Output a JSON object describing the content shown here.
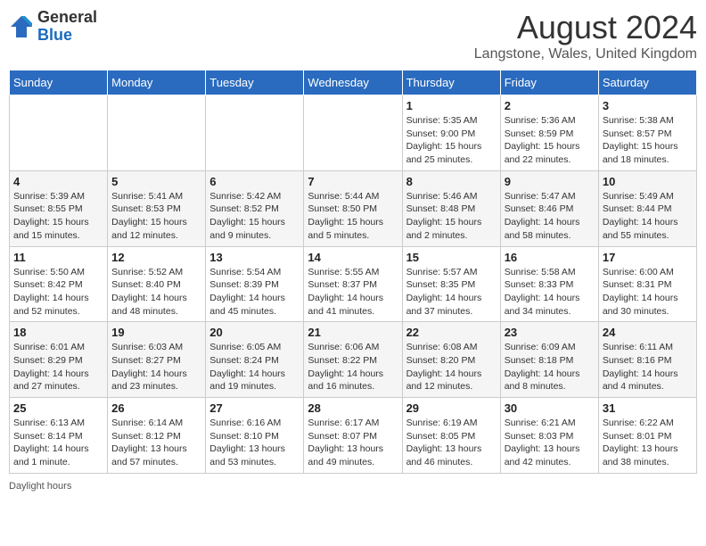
{
  "header": {
    "logo_general": "General",
    "logo_blue": "Blue",
    "main_title": "August 2024",
    "subtitle": "Langstone, Wales, United Kingdom"
  },
  "weekdays": [
    "Sunday",
    "Monday",
    "Tuesday",
    "Wednesday",
    "Thursday",
    "Friday",
    "Saturday"
  ],
  "weeks": [
    [
      {
        "num": "",
        "info": ""
      },
      {
        "num": "",
        "info": ""
      },
      {
        "num": "",
        "info": ""
      },
      {
        "num": "",
        "info": ""
      },
      {
        "num": "1",
        "info": "Sunrise: 5:35 AM\nSunset: 9:00 PM\nDaylight: 15 hours\nand 25 minutes."
      },
      {
        "num": "2",
        "info": "Sunrise: 5:36 AM\nSunset: 8:59 PM\nDaylight: 15 hours\nand 22 minutes."
      },
      {
        "num": "3",
        "info": "Sunrise: 5:38 AM\nSunset: 8:57 PM\nDaylight: 15 hours\nand 18 minutes."
      }
    ],
    [
      {
        "num": "4",
        "info": "Sunrise: 5:39 AM\nSunset: 8:55 PM\nDaylight: 15 hours\nand 15 minutes."
      },
      {
        "num": "5",
        "info": "Sunrise: 5:41 AM\nSunset: 8:53 PM\nDaylight: 15 hours\nand 12 minutes."
      },
      {
        "num": "6",
        "info": "Sunrise: 5:42 AM\nSunset: 8:52 PM\nDaylight: 15 hours\nand 9 minutes."
      },
      {
        "num": "7",
        "info": "Sunrise: 5:44 AM\nSunset: 8:50 PM\nDaylight: 15 hours\nand 5 minutes."
      },
      {
        "num": "8",
        "info": "Sunrise: 5:46 AM\nSunset: 8:48 PM\nDaylight: 15 hours\nand 2 minutes."
      },
      {
        "num": "9",
        "info": "Sunrise: 5:47 AM\nSunset: 8:46 PM\nDaylight: 14 hours\nand 58 minutes."
      },
      {
        "num": "10",
        "info": "Sunrise: 5:49 AM\nSunset: 8:44 PM\nDaylight: 14 hours\nand 55 minutes."
      }
    ],
    [
      {
        "num": "11",
        "info": "Sunrise: 5:50 AM\nSunset: 8:42 PM\nDaylight: 14 hours\nand 52 minutes."
      },
      {
        "num": "12",
        "info": "Sunrise: 5:52 AM\nSunset: 8:40 PM\nDaylight: 14 hours\nand 48 minutes."
      },
      {
        "num": "13",
        "info": "Sunrise: 5:54 AM\nSunset: 8:39 PM\nDaylight: 14 hours\nand 45 minutes."
      },
      {
        "num": "14",
        "info": "Sunrise: 5:55 AM\nSunset: 8:37 PM\nDaylight: 14 hours\nand 41 minutes."
      },
      {
        "num": "15",
        "info": "Sunrise: 5:57 AM\nSunset: 8:35 PM\nDaylight: 14 hours\nand 37 minutes."
      },
      {
        "num": "16",
        "info": "Sunrise: 5:58 AM\nSunset: 8:33 PM\nDaylight: 14 hours\nand 34 minutes."
      },
      {
        "num": "17",
        "info": "Sunrise: 6:00 AM\nSunset: 8:31 PM\nDaylight: 14 hours\nand 30 minutes."
      }
    ],
    [
      {
        "num": "18",
        "info": "Sunrise: 6:01 AM\nSunset: 8:29 PM\nDaylight: 14 hours\nand 27 minutes."
      },
      {
        "num": "19",
        "info": "Sunrise: 6:03 AM\nSunset: 8:27 PM\nDaylight: 14 hours\nand 23 minutes."
      },
      {
        "num": "20",
        "info": "Sunrise: 6:05 AM\nSunset: 8:24 PM\nDaylight: 14 hours\nand 19 minutes."
      },
      {
        "num": "21",
        "info": "Sunrise: 6:06 AM\nSunset: 8:22 PM\nDaylight: 14 hours\nand 16 minutes."
      },
      {
        "num": "22",
        "info": "Sunrise: 6:08 AM\nSunset: 8:20 PM\nDaylight: 14 hours\nand 12 minutes."
      },
      {
        "num": "23",
        "info": "Sunrise: 6:09 AM\nSunset: 8:18 PM\nDaylight: 14 hours\nand 8 minutes."
      },
      {
        "num": "24",
        "info": "Sunrise: 6:11 AM\nSunset: 8:16 PM\nDaylight: 14 hours\nand 4 minutes."
      }
    ],
    [
      {
        "num": "25",
        "info": "Sunrise: 6:13 AM\nSunset: 8:14 PM\nDaylight: 14 hours\nand 1 minute."
      },
      {
        "num": "26",
        "info": "Sunrise: 6:14 AM\nSunset: 8:12 PM\nDaylight: 13 hours\nand 57 minutes."
      },
      {
        "num": "27",
        "info": "Sunrise: 6:16 AM\nSunset: 8:10 PM\nDaylight: 13 hours\nand 53 minutes."
      },
      {
        "num": "28",
        "info": "Sunrise: 6:17 AM\nSunset: 8:07 PM\nDaylight: 13 hours\nand 49 minutes."
      },
      {
        "num": "29",
        "info": "Sunrise: 6:19 AM\nSunset: 8:05 PM\nDaylight: 13 hours\nand 46 minutes."
      },
      {
        "num": "30",
        "info": "Sunrise: 6:21 AM\nSunset: 8:03 PM\nDaylight: 13 hours\nand 42 minutes."
      },
      {
        "num": "31",
        "info": "Sunrise: 6:22 AM\nSunset: 8:01 PM\nDaylight: 13 hours\nand 38 minutes."
      }
    ]
  ],
  "footer": {
    "daylight_label": "Daylight hours"
  }
}
